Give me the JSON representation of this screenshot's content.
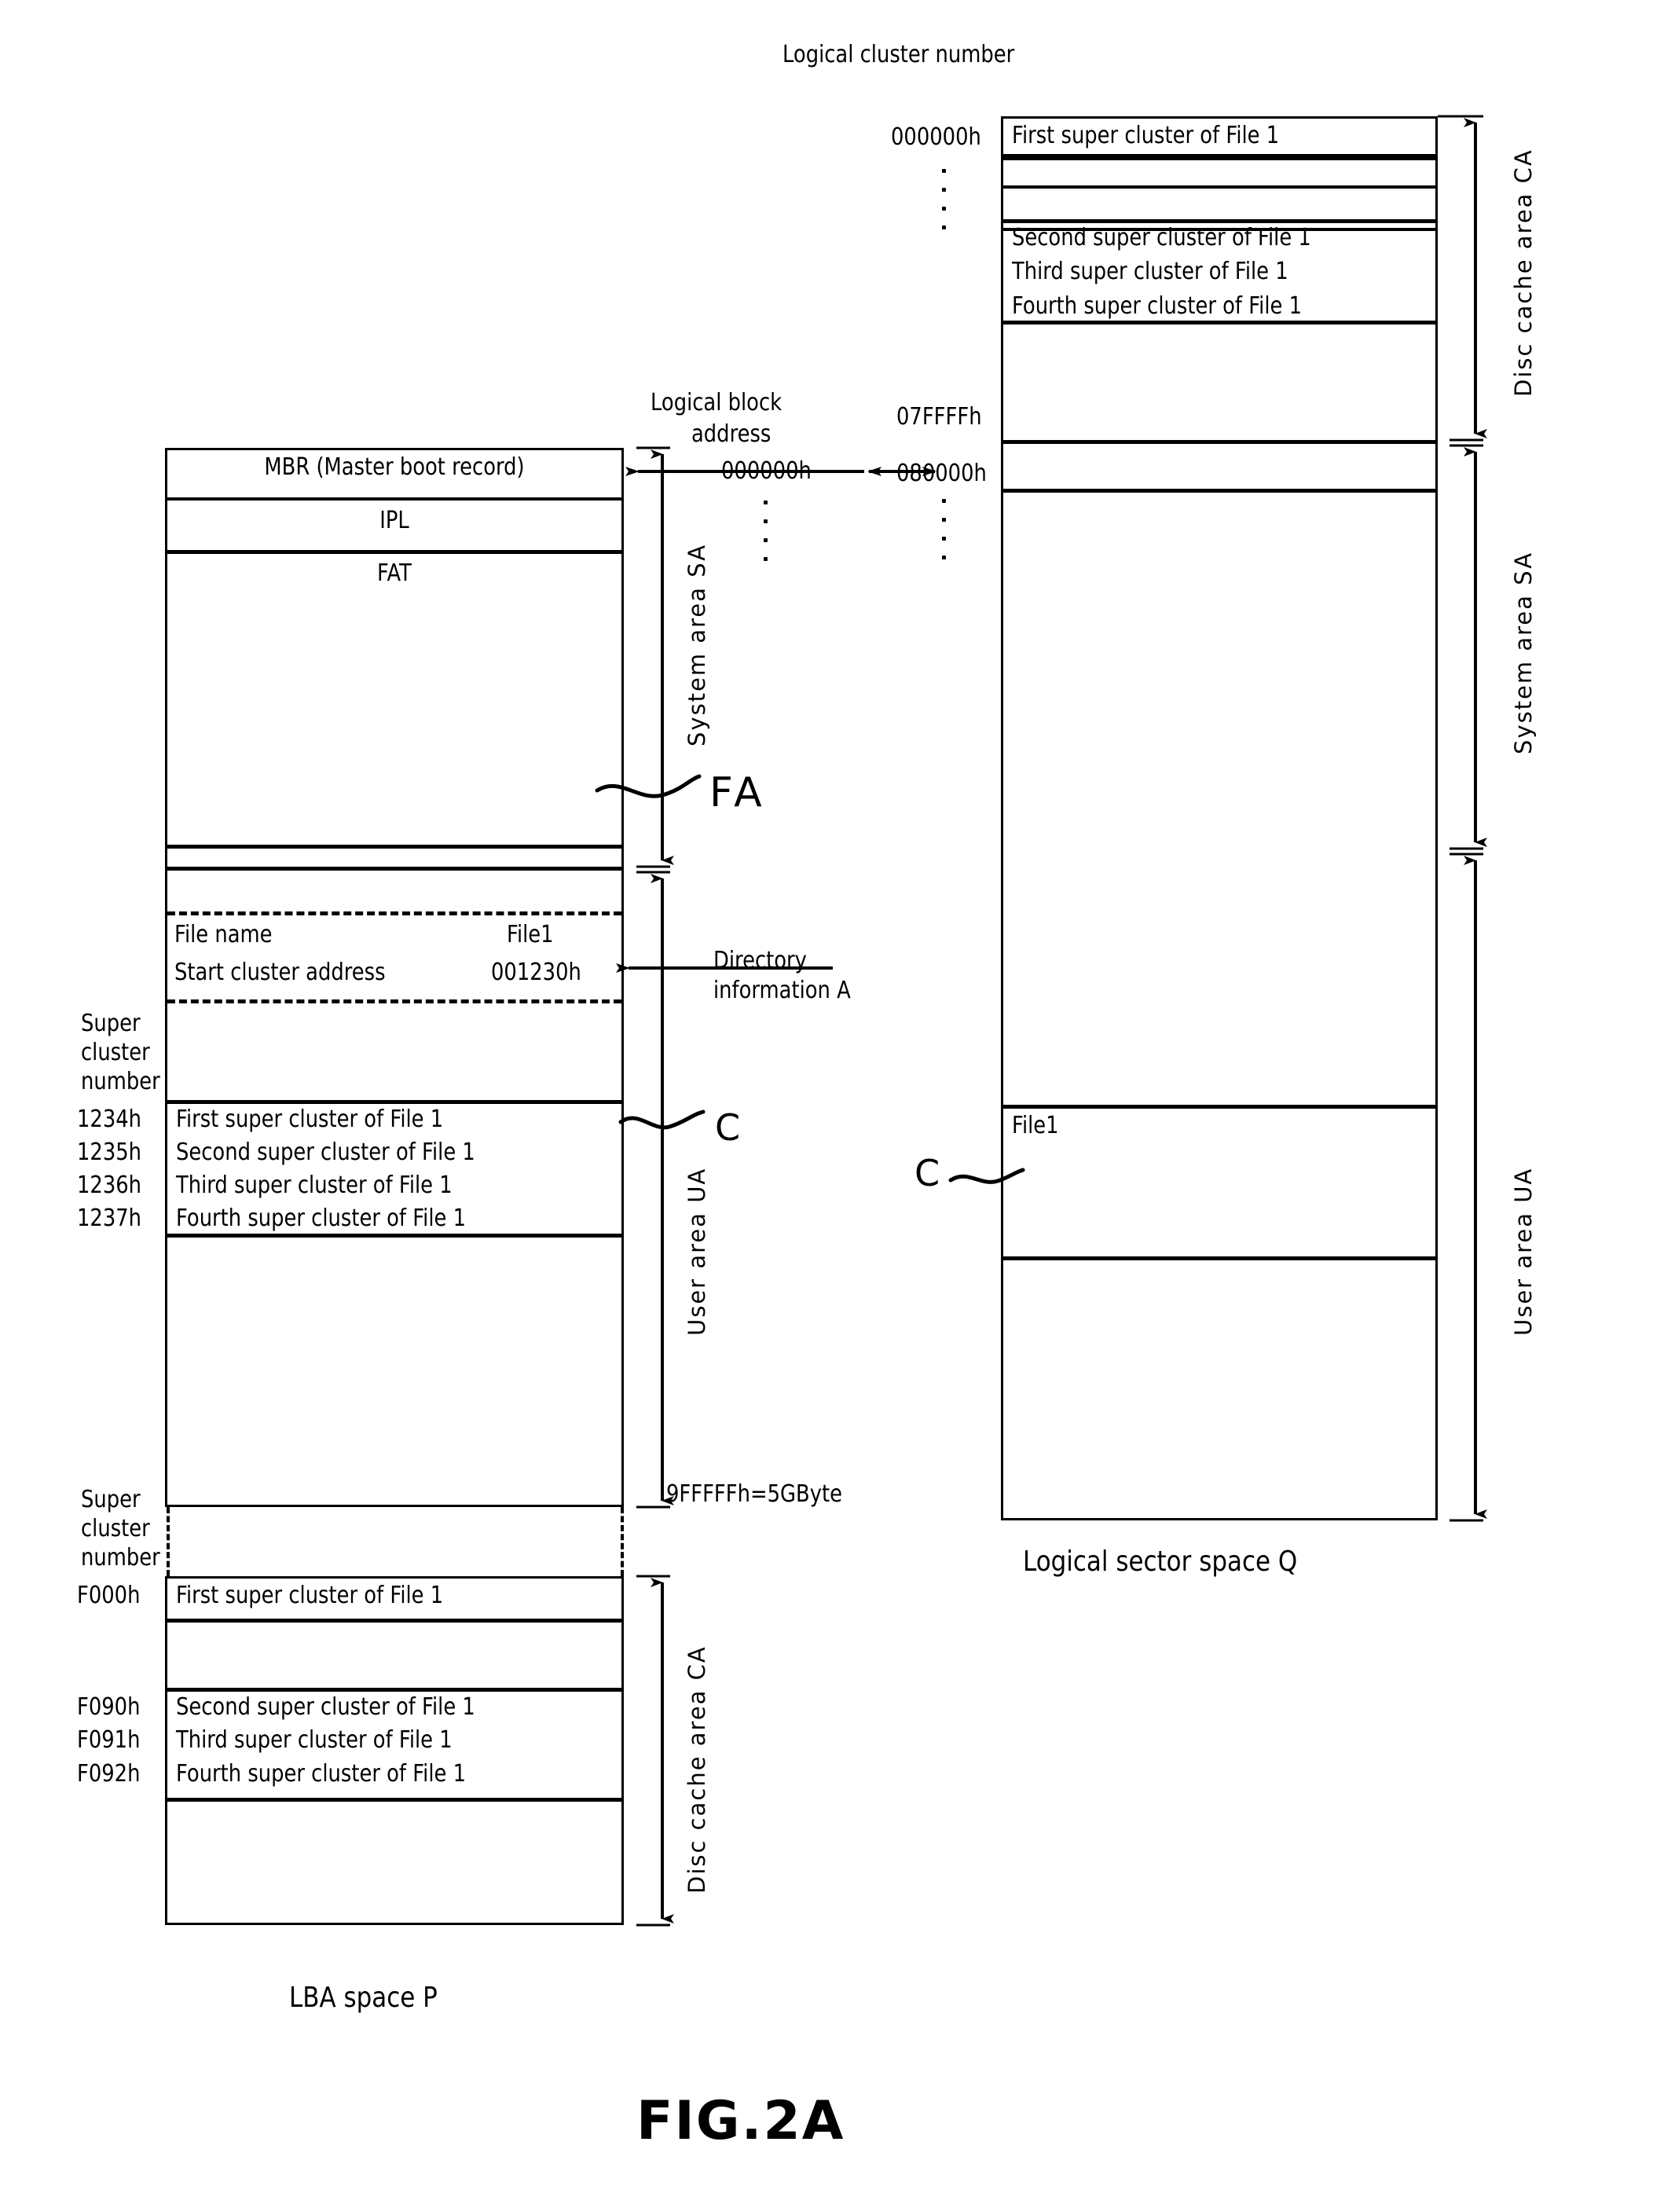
{
  "figure": {
    "caption": "FIG.2A"
  },
  "left_diagram": {
    "title": "LBA space P",
    "axis_label": "Logical block\naddress",
    "axis_label_line1": "Logical block",
    "axis_label_line2": "address",
    "start_address": "000000h",
    "end_address": "9FFFFFh=5GByte",
    "bracket_labels": {
      "system_area": "System area SA",
      "user_area": "User area UA",
      "disc_cache_area": "Disc cache area CA"
    },
    "super_cluster_number_label_1": "Super\ncluster\nnumber",
    "super_cluster_number_label_2": "Super\ncluster\nnumber",
    "scn_label_lines": [
      "Super",
      "cluster",
      "number"
    ],
    "system_rows": [
      {
        "label": "MBR (Master boot record)"
      },
      {
        "label": "IPL"
      },
      {
        "label": "FAT"
      }
    ],
    "directory_info": {
      "callout": "Directory\ninformation A",
      "callout_line1": "Directory",
      "callout_line2": "information A",
      "rows": [
        {
          "key": "File name",
          "value": "File1"
        },
        {
          "key": "Start cluster address",
          "value": "001230h"
        }
      ]
    },
    "user_clusters": [
      {
        "number": "1234h",
        "label": "First super cluster of File 1"
      },
      {
        "number": "1235h",
        "label": "Second super cluster of File 1"
      },
      {
        "number": "1236h",
        "label": "Third super cluster of File 1"
      },
      {
        "number": "1237h",
        "label": "Fourth super cluster of File 1"
      }
    ],
    "cache_clusters": [
      {
        "number": "F000h",
        "label": "First super cluster of File 1"
      },
      {
        "number": "F090h",
        "label": "Second super cluster of File 1"
      },
      {
        "number": "F091h",
        "label": "Third super cluster of File 1"
      },
      {
        "number": "F092h",
        "label": "Fourth super cluster of File 1"
      }
    ],
    "fa_marker": "FA",
    "c_marker": "C"
  },
  "right_diagram": {
    "title": "Logical sector space Q",
    "axis_label": "Logical cluster number",
    "addresses": {
      "start": "000000h",
      "cache_end": "07FFFFh",
      "system_start": "080000h"
    },
    "bracket_labels": {
      "disc_cache_area": "Disc cache area CA",
      "system_area": "System area SA",
      "user_area": "User area UA"
    },
    "cache_rows": [
      {
        "label": "First super cluster of File 1"
      },
      {
        "label": ""
      },
      {
        "label": "Second super cluster of File 1"
      },
      {
        "label": "Third super cluster of File 1"
      },
      {
        "label": "Fourth super cluster of File 1"
      }
    ],
    "user_file_label": "File1",
    "c_marker": "C"
  }
}
